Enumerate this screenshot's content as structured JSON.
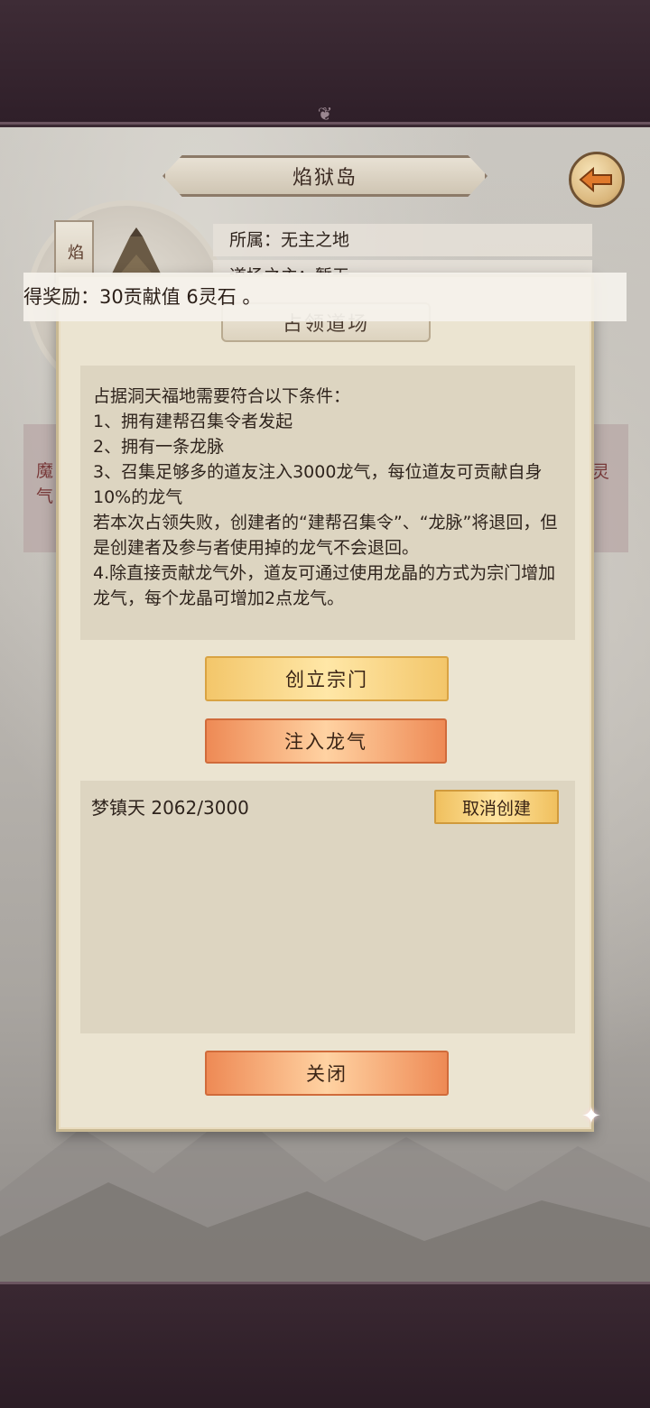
{
  "location": {
    "title": "焰狱岛",
    "scroll_label": "焰",
    "owner_row": "所属：无主之地",
    "master_row": "道场之主：暂无",
    "side_left": "魔\n气",
    "side_right": "灵"
  },
  "toast": {
    "text": "得奖励：30贡献值 6灵石 。"
  },
  "modal": {
    "header": "占领道场",
    "rules": [
      "占据洞天福地需要符合以下条件：",
      "1、拥有建帮召集令者发起",
      "2、拥有一条龙脉",
      "3、召集足够多的道友注入3000龙气，每位道友可贡献自身10%的龙气",
      "若本次占领失败，创建者的“建帮召集令”、“龙脉”将退回，但是创建者及参与者使用掉的龙气不会退回。",
      "4.除直接贡献龙气外，道友可通过使用龙晶的方式为宗门增加龙气，每个龙晶可增加2点龙气。"
    ],
    "create_sect_label": "创立宗门",
    "inject_label": "注入龙气",
    "progress_text": "梦镇天 2062/3000",
    "cancel_label": "取消创建",
    "close_label": "关闭"
  },
  "icons": {
    "back": "back-arrow-icon",
    "sparkle": "sparkle-icon"
  },
  "colors": {
    "gold_button": "#f3c66a",
    "orange_button": "#ee8a55",
    "modal_bg": "#ebe4d1"
  }
}
